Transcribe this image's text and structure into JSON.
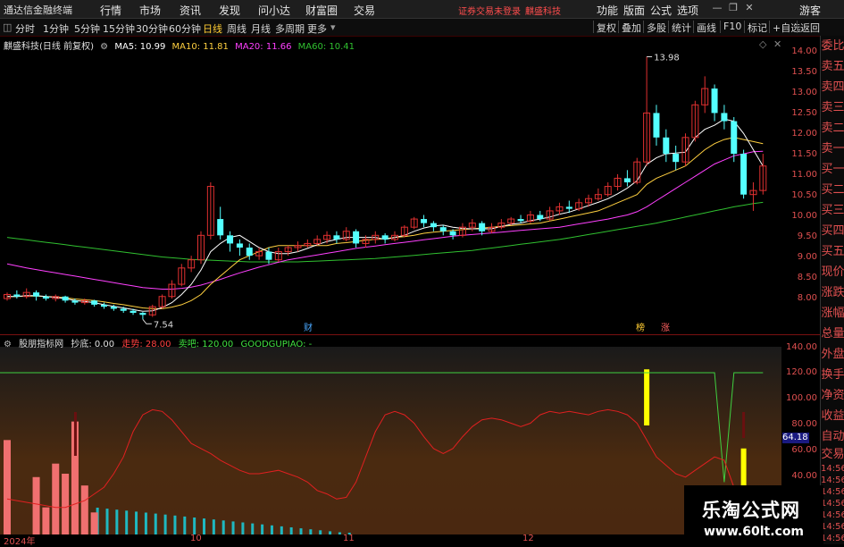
{
  "menubar": {
    "app_title": "通达信金融终端",
    "items": [
      "行情",
      "市场",
      "资讯",
      "发现",
      "问小达",
      "财富圈",
      "交易"
    ],
    "login_status": "证券交易未登录",
    "window_title": "麒盛科技",
    "right_items": [
      "功能",
      "版面",
      "公式",
      "选项"
    ],
    "guest": "游客"
  },
  "periodbar": {
    "periods": [
      "分时",
      "1分钟",
      "5分钟",
      "15分钟",
      "30分钟",
      "60分钟",
      "日线",
      "周线",
      "月线",
      "多周期",
      "更多"
    ],
    "active": "日线",
    "tools": [
      "复权",
      "叠加",
      "多股",
      "统计",
      "画线",
      "F10",
      "标记",
      "+自选",
      "返回"
    ]
  },
  "legend": {
    "title": "麒盛科技(日线 前复权)",
    "ma5": "MA5: 10.99",
    "ma10": "MA10: 11.81",
    "ma20": "MA20: 11.66",
    "ma60": "MA60: 10.41"
  },
  "price_axis": [
    "14.00",
    "13.50",
    "13.00",
    "12.50",
    "12.00",
    "11.50",
    "11.00",
    "10.50",
    "10.00",
    "9.50",
    "9.00",
    "8.50",
    "8.00"
  ],
  "annotations": {
    "high": "13.98",
    "low": "7.54",
    "tag_cai": "财",
    "tag_bang": "榜",
    "tag_zhang": "涨"
  },
  "sidebar": [
    "委比",
    "卖五",
    "卖四",
    "卖三",
    "卖二",
    "卖一",
    "买一",
    "买二",
    "买三",
    "买四",
    "买五",
    "现价",
    "涨跌",
    "涨幅",
    "总量",
    "外盘",
    "换手",
    "净资",
    "收益",
    "自动",
    "交易",
    "14:56",
    "14:56",
    "14:56",
    "14:56",
    "14:56",
    "14:56",
    "14:56"
  ],
  "indicator": {
    "name": "股朋指标网",
    "chaodi": "抄底: 0.00",
    "zoushi": "走势: 28.00",
    "maiba": "卖吧: 120.00",
    "site": "GOODGUPIAO: -",
    "sell_label": "卖吧",
    "value_tag": "64.18"
  },
  "ind_axis": [
    "140.00",
    "120.00",
    "100.00",
    "80.00",
    "60.00",
    "40.00"
  ],
  "date_axis": [
    "2024年",
    "10",
    "11",
    "12"
  ],
  "watermark": {
    "name": "乐淘公式网",
    "url": "www.60lt.com"
  },
  "colors": {
    "up": "#e03030",
    "down": "#54ffff",
    "ma5": "#ffffff",
    "ma10": "#ffd040",
    "ma20": "#ff40ff",
    "ma60": "#30c030"
  },
  "chart_data": {
    "type": "candlestick",
    "ylim": [
      7.5,
      14.2
    ],
    "candles": [
      [
        8.05,
        8.15,
        8.2,
        8.0
      ],
      [
        8.15,
        8.1,
        8.25,
        8.05
      ],
      [
        8.1,
        8.2,
        8.3,
        8.05
      ],
      [
        8.2,
        8.1,
        8.25,
        8.0
      ],
      [
        8.1,
        8.05,
        8.15,
        8.0
      ],
      [
        8.05,
        8.1,
        8.15,
        7.98
      ],
      [
        8.1,
        8.0,
        8.12,
        7.95
      ],
      [
        8.0,
        7.95,
        8.05,
        7.9
      ],
      [
        7.95,
        8.0,
        8.05,
        7.9
      ],
      [
        8.0,
        7.9,
        8.02,
        7.85
      ],
      [
        7.9,
        7.85,
        7.95,
        7.8
      ],
      [
        7.85,
        7.8,
        7.9,
        7.75
      ],
      [
        7.8,
        7.75,
        7.85,
        7.7
      ],
      [
        7.75,
        7.7,
        7.8,
        7.65
      ],
      [
        7.7,
        7.65,
        7.72,
        7.54
      ],
      [
        7.65,
        7.85,
        7.9,
        7.6
      ],
      [
        7.85,
        8.1,
        8.15,
        7.8
      ],
      [
        8.1,
        8.4,
        8.5,
        8.05
      ],
      [
        8.4,
        8.8,
        8.9,
        8.35
      ],
      [
        8.8,
        9.0,
        9.1,
        8.7
      ],
      [
        9.0,
        9.6,
        9.7,
        8.9
      ],
      [
        9.6,
        10.8,
        10.9,
        9.5
      ],
      [
        10.0,
        9.6,
        10.3,
        9.5
      ],
      [
        9.6,
        9.4,
        9.7,
        9.2
      ],
      [
        9.4,
        9.3,
        9.5,
        9.1
      ],
      [
        9.3,
        9.1,
        9.4,
        9.0
      ],
      [
        9.1,
        9.2,
        9.3,
        9.0
      ],
      [
        9.2,
        9.0,
        9.3,
        8.9
      ],
      [
        9.0,
        9.2,
        9.3,
        8.95
      ],
      [
        9.2,
        9.3,
        9.35,
        9.1
      ],
      [
        9.3,
        9.35,
        9.45,
        9.2
      ],
      [
        9.35,
        9.4,
        9.5,
        9.3
      ],
      [
        9.4,
        9.5,
        9.6,
        9.35
      ],
      [
        9.5,
        9.6,
        9.7,
        9.4
      ],
      [
        9.6,
        9.5,
        9.7,
        9.4
      ],
      [
        9.5,
        9.7,
        9.8,
        9.45
      ],
      [
        9.7,
        9.4,
        9.75,
        9.3
      ],
      [
        9.4,
        9.5,
        9.6,
        9.3
      ],
      [
        9.5,
        9.6,
        9.7,
        9.4
      ],
      [
        9.6,
        9.5,
        9.65,
        9.4
      ],
      [
        9.5,
        9.6,
        9.7,
        9.45
      ],
      [
        9.6,
        9.8,
        9.85,
        9.55
      ],
      [
        9.8,
        10.0,
        10.05,
        9.75
      ],
      [
        10.0,
        9.9,
        10.1,
        9.8
      ],
      [
        9.9,
        9.8,
        9.95,
        9.7
      ],
      [
        9.8,
        9.7,
        9.85,
        9.6
      ],
      [
        9.7,
        9.6,
        9.75,
        9.5
      ],
      [
        9.6,
        9.8,
        9.9,
        9.55
      ],
      [
        9.8,
        9.9,
        10.0,
        9.7
      ],
      [
        9.9,
        9.7,
        9.95,
        9.6
      ],
      [
        9.7,
        9.8,
        9.9,
        9.65
      ],
      [
        9.8,
        9.9,
        10.0,
        9.75
      ],
      [
        9.9,
        10.0,
        10.05,
        9.85
      ],
      [
        10.0,
        9.95,
        10.1,
        9.9
      ],
      [
        9.95,
        10.1,
        10.2,
        9.9
      ],
      [
        10.1,
        10.0,
        10.2,
        9.95
      ],
      [
        10.0,
        10.2,
        10.3,
        9.95
      ],
      [
        10.2,
        10.3,
        10.4,
        10.1
      ],
      [
        10.3,
        10.25,
        10.45,
        10.15
      ],
      [
        10.25,
        10.4,
        10.5,
        10.2
      ],
      [
        10.4,
        10.5,
        10.6,
        10.3
      ],
      [
        10.5,
        10.6,
        10.75,
        10.45
      ],
      [
        10.6,
        10.8,
        10.9,
        10.55
      ],
      [
        10.8,
        11.0,
        11.1,
        10.7
      ],
      [
        11.0,
        10.9,
        11.2,
        10.8
      ],
      [
        10.9,
        11.4,
        11.5,
        10.85
      ],
      [
        11.4,
        12.6,
        13.98,
        11.3
      ],
      [
        12.6,
        12.0,
        12.8,
        11.8
      ],
      [
        12.0,
        11.6,
        12.2,
        11.4
      ],
      [
        11.6,
        11.4,
        11.8,
        11.2
      ],
      [
        11.4,
        12.0,
        12.1,
        11.3
      ],
      [
        12.0,
        12.8,
        12.9,
        11.9
      ],
      [
        12.8,
        13.2,
        13.5,
        12.6
      ],
      [
        13.2,
        12.6,
        13.3,
        12.4
      ],
      [
        12.6,
        12.4,
        12.8,
        12.2
      ],
      [
        12.4,
        11.6,
        12.5,
        11.4
      ],
      [
        11.6,
        10.6,
        11.7,
        10.5
      ],
      [
        10.6,
        10.7,
        10.9,
        10.2
      ],
      [
        10.7,
        11.3,
        11.6,
        10.6
      ]
    ],
    "ma5": [
      8.1,
      8.1,
      8.12,
      8.12,
      8.1,
      8.08,
      8.05,
      8.0,
      7.98,
      7.95,
      7.9,
      7.86,
      7.82,
      7.78,
      7.74,
      7.75,
      7.83,
      7.95,
      8.15,
      8.4,
      8.75,
      9.2,
      9.4,
      9.55,
      9.6,
      9.45,
      9.3,
      9.2,
      9.15,
      9.15,
      9.2,
      9.28,
      9.37,
      9.45,
      9.5,
      9.55,
      9.55,
      9.55,
      9.55,
      9.5,
      9.55,
      9.6,
      9.7,
      9.78,
      9.83,
      9.85,
      9.8,
      9.77,
      9.76,
      9.76,
      9.76,
      9.82,
      9.87,
      9.9,
      9.96,
      10.0,
      10.05,
      10.12,
      10.17,
      10.25,
      10.33,
      10.41,
      10.5,
      10.62,
      10.76,
      10.94,
      11.34,
      11.5,
      11.6,
      11.62,
      11.64,
      12.0,
      12.2,
      12.3,
      12.45,
      12.4,
      12.1,
      11.7,
      11.3
    ],
    "ma10": [
      8.1,
      8.1,
      8.11,
      8.11,
      8.1,
      8.09,
      8.07,
      8.04,
      8.02,
      8.0,
      7.97,
      7.93,
      7.9,
      7.86,
      7.82,
      7.8,
      7.8,
      7.84,
      7.9,
      8.0,
      8.15,
      8.4,
      8.6,
      8.8,
      9.0,
      9.1,
      9.2,
      9.3,
      9.35,
      9.35,
      9.35,
      9.35,
      9.35,
      9.35,
      9.4,
      9.42,
      9.45,
      9.48,
      9.5,
      9.52,
      9.55,
      9.57,
      9.6,
      9.65,
      9.68,
      9.7,
      9.72,
      9.74,
      9.76,
      9.78,
      9.8,
      9.82,
      9.84,
      9.86,
      9.88,
      9.9,
      9.95,
      10.0,
      10.05,
      10.1,
      10.15,
      10.2,
      10.3,
      10.4,
      10.5,
      10.6,
      10.85,
      11.0,
      11.1,
      11.2,
      11.3,
      11.5,
      11.7,
      11.85,
      11.95,
      12.0,
      11.95,
      11.9,
      11.85
    ],
    "ma20": [
      8.9,
      8.85,
      8.8,
      8.76,
      8.72,
      8.68,
      8.64,
      8.6,
      8.56,
      8.52,
      8.48,
      8.44,
      8.4,
      8.36,
      8.32,
      8.3,
      8.28,
      8.28,
      8.3,
      8.33,
      8.38,
      8.45,
      8.52,
      8.6,
      8.68,
      8.75,
      8.82,
      8.88,
      8.94,
      9.0,
      9.04,
      9.08,
      9.12,
      9.16,
      9.2,
      9.24,
      9.28,
      9.31,
      9.34,
      9.37,
      9.4,
      9.43,
      9.46,
      9.49,
      9.52,
      9.55,
      9.58,
      9.6,
      9.62,
      9.64,
      9.66,
      9.68,
      9.7,
      9.72,
      9.74,
      9.76,
      9.78,
      9.8,
      9.84,
      9.88,
      9.92,
      9.96,
      10.0,
      10.05,
      10.1,
      10.18,
      10.3,
      10.45,
      10.6,
      10.75,
      10.9,
      11.05,
      11.2,
      11.35,
      11.45,
      11.55,
      11.6,
      11.65,
      11.66
    ],
    "ma60": [
      9.55,
      9.52,
      9.49,
      9.46,
      9.43,
      9.4,
      9.37,
      9.34,
      9.31,
      9.28,
      9.25,
      9.22,
      9.19,
      9.16,
      9.13,
      9.1,
      9.07,
      9.05,
      9.03,
      9.01,
      9.0,
      8.99,
      8.98,
      8.97,
      8.96,
      8.95,
      8.95,
      8.95,
      8.95,
      8.95,
      8.95,
      8.96,
      8.97,
      8.98,
      8.99,
      9.0,
      9.01,
      9.02,
      9.03,
      9.05,
      9.07,
      9.09,
      9.11,
      9.13,
      9.15,
      9.17,
      9.19,
      9.21,
      9.23,
      9.26,
      9.29,
      9.32,
      9.35,
      9.38,
      9.41,
      9.44,
      9.47,
      9.5,
      9.54,
      9.58,
      9.62,
      9.66,
      9.7,
      9.74,
      9.78,
      9.82,
      9.86,
      9.9,
      9.95,
      10.0,
      10.05,
      10.1,
      10.15,
      10.2,
      10.25,
      10.3,
      10.34,
      10.38,
      10.41
    ],
    "indicator": {
      "ylim": [
        20,
        145
      ],
      "line_zoushi": [
        45,
        44,
        43,
        42,
        41,
        40,
        40,
        42,
        44,
        48,
        52,
        60,
        70,
        85,
        95,
        98,
        97,
        92,
        85,
        78,
        75,
        72,
        68,
        65,
        62,
        60,
        60,
        61,
        62,
        60,
        58,
        55,
        50,
        48,
        45,
        46,
        55,
        70,
        85,
        95,
        97,
        95,
        90,
        82,
        75,
        72,
        75,
        82,
        88,
        92,
        93,
        92,
        90,
        88,
        90,
        95,
        97,
        96,
        97,
        96,
        95,
        97,
        98,
        97,
        95,
        90,
        80,
        70,
        65,
        60,
        58,
        62,
        66,
        70,
        68,
        52,
        45,
        42,
        38
      ],
      "line_maiba": [
        120,
        120,
        120,
        120,
        120,
        120,
        120,
        120,
        120,
        120,
        120,
        120,
        120,
        120,
        120,
        120,
        120,
        120,
        120,
        120,
        120,
        120,
        120,
        120,
        120,
        120,
        120,
        120,
        120,
        120,
        120,
        120,
        120,
        120,
        120,
        120,
        120,
        120,
        120,
        120,
        120,
        120,
        120,
        120,
        120,
        120,
        120,
        120,
        120,
        120,
        120,
        120,
        120,
        120,
        120,
        120,
        120,
        120,
        120,
        120,
        120,
        120,
        120,
        120,
        120,
        120,
        120,
        120,
        120,
        120,
        120,
        120,
        120,
        120,
        55,
        120,
        120,
        120,
        120
      ],
      "bars_red": [
        [
          0,
          80
        ],
        [
          3,
          58
        ],
        [
          4,
          40
        ],
        [
          5,
          66
        ],
        [
          6,
          60
        ],
        [
          7,
          91
        ],
        [
          8,
          53
        ],
        [
          9,
          37
        ]
      ],
      "bars_yellow": [
        [
          66,
          122
        ],
        [
          76,
          75
        ]
      ]
    }
  }
}
